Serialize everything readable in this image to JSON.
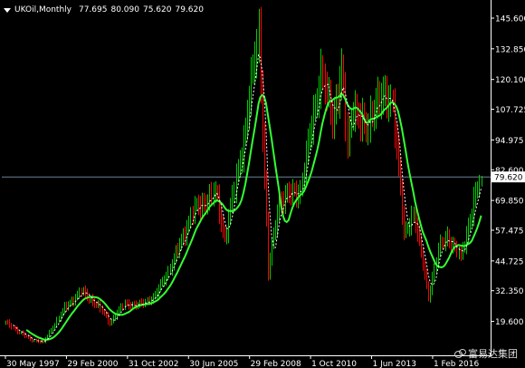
{
  "header": {
    "symbol": "UKOil,Monthly",
    "open": "77.695",
    "high": "80.090",
    "low": "75.620",
    "close": "79.620"
  },
  "watermark": "富易达集团",
  "colors": {
    "background": "#000000",
    "bull_candle": "#00cc00",
    "bear_candle": "#ff0000",
    "ma_slow": "#33ff33",
    "ma_fast": "#ffffff",
    "price_line": "#6c8296",
    "axis_text": "#ffffff",
    "current_price_tag": "#ffffff"
  },
  "chart_data": {
    "type": "candlestick",
    "x_tick_labels": [
      "30 May 1997",
      "29 Feb 2000",
      "31 Oct 2002",
      "30 Jun 2005",
      "29 Feb 2008",
      "1 Oct 2010",
      "1 Jun 2013",
      "1 Feb 2016"
    ],
    "y_tick_labels": [
      "145.600",
      "132.850",
      "120.100",
      "107.725",
      "94.975",
      "82.600",
      "69.850",
      "57.475",
      "44.725",
      "32.350",
      "19.600"
    ],
    "y_ticks": [
      145.6,
      132.85,
      120.1,
      107.725,
      94.975,
      82.6,
      69.85,
      57.475,
      44.725,
      32.35,
      19.6
    ],
    "current_price": 79.62,
    "current_price_label": "79.620",
    "ylim": [
      5.5,
      152
    ],
    "indicators": [
      {
        "name": "slow moving average",
        "style": "solid",
        "color": "#33ff33"
      },
      {
        "name": "fast moving average",
        "style": "dashed",
        "color": "#ffffff"
      }
    ],
    "trajectory": [
      [
        "1997-05",
        19
      ],
      [
        "1998-06",
        12
      ],
      [
        "1999-01",
        11
      ],
      [
        "1999-12",
        25
      ],
      [
        "2000-09",
        32
      ],
      [
        "2001-06",
        26
      ],
      [
        "2001-12",
        19
      ],
      [
        "2002-08",
        27
      ],
      [
        "2003-03",
        26
      ],
      [
        "2003-12",
        30
      ],
      [
        "2004-10",
        45
      ],
      [
        "2005-08",
        65
      ],
      [
        "2006-08",
        73
      ],
      [
        "2007-01",
        54
      ],
      [
        "2007-11",
        95
      ],
      [
        "2008-07",
        140
      ],
      [
        "2008-12",
        40
      ],
      [
        "2009-06",
        70
      ],
      [
        "2010-05",
        74
      ],
      [
        "2011-04",
        123
      ],
      [
        "2011-10",
        103
      ],
      [
        "2012-03",
        124
      ],
      [
        "2012-06",
        91
      ],
      [
        "2012-09",
        110
      ],
      [
        "2013-04",
        98
      ],
      [
        "2013-09",
        112
      ],
      [
        "2014-06",
        111
      ],
      [
        "2014-12",
        55
      ],
      [
        "2015-05",
        65
      ],
      [
        "2016-01",
        30
      ],
      [
        "2016-06",
        49
      ],
      [
        "2016-11",
        55
      ],
      [
        "2017-06",
        46
      ],
      [
        "2018-01",
        69
      ],
      [
        "2018-05",
        79.62
      ]
    ]
  }
}
